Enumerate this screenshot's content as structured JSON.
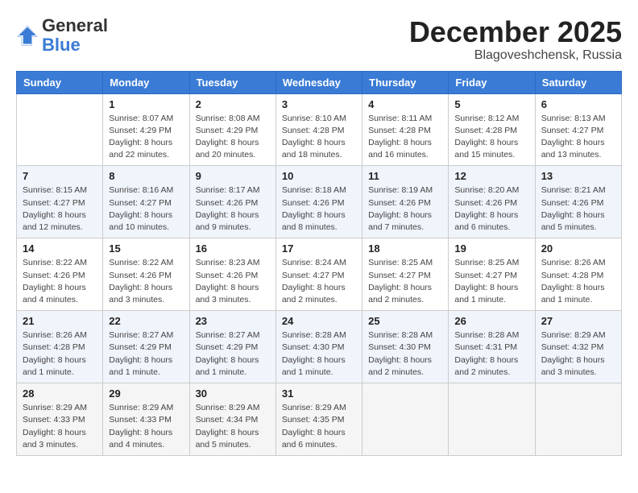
{
  "logo": {
    "general": "General",
    "blue": "Blue"
  },
  "title": {
    "month": "December 2025",
    "location": "Blagoveshchensk, Russia"
  },
  "weekdays": [
    "Sunday",
    "Monday",
    "Tuesday",
    "Wednesday",
    "Thursday",
    "Friday",
    "Saturday"
  ],
  "weeks": [
    [
      {
        "day": "",
        "info": ""
      },
      {
        "day": "1",
        "info": "Sunrise: 8:07 AM\nSunset: 4:29 PM\nDaylight: 8 hours\nand 22 minutes."
      },
      {
        "day": "2",
        "info": "Sunrise: 8:08 AM\nSunset: 4:29 PM\nDaylight: 8 hours\nand 20 minutes."
      },
      {
        "day": "3",
        "info": "Sunrise: 8:10 AM\nSunset: 4:28 PM\nDaylight: 8 hours\nand 18 minutes."
      },
      {
        "day": "4",
        "info": "Sunrise: 8:11 AM\nSunset: 4:28 PM\nDaylight: 8 hours\nand 16 minutes."
      },
      {
        "day": "5",
        "info": "Sunrise: 8:12 AM\nSunset: 4:28 PM\nDaylight: 8 hours\nand 15 minutes."
      },
      {
        "day": "6",
        "info": "Sunrise: 8:13 AM\nSunset: 4:27 PM\nDaylight: 8 hours\nand 13 minutes."
      }
    ],
    [
      {
        "day": "7",
        "info": "Sunrise: 8:15 AM\nSunset: 4:27 PM\nDaylight: 8 hours\nand 12 minutes."
      },
      {
        "day": "8",
        "info": "Sunrise: 8:16 AM\nSunset: 4:27 PM\nDaylight: 8 hours\nand 10 minutes."
      },
      {
        "day": "9",
        "info": "Sunrise: 8:17 AM\nSunset: 4:26 PM\nDaylight: 8 hours\nand 9 minutes."
      },
      {
        "day": "10",
        "info": "Sunrise: 8:18 AM\nSunset: 4:26 PM\nDaylight: 8 hours\nand 8 minutes."
      },
      {
        "day": "11",
        "info": "Sunrise: 8:19 AM\nSunset: 4:26 PM\nDaylight: 8 hours\nand 7 minutes."
      },
      {
        "day": "12",
        "info": "Sunrise: 8:20 AM\nSunset: 4:26 PM\nDaylight: 8 hours\nand 6 minutes."
      },
      {
        "day": "13",
        "info": "Sunrise: 8:21 AM\nSunset: 4:26 PM\nDaylight: 8 hours\nand 5 minutes."
      }
    ],
    [
      {
        "day": "14",
        "info": "Sunrise: 8:22 AM\nSunset: 4:26 PM\nDaylight: 8 hours\nand 4 minutes."
      },
      {
        "day": "15",
        "info": "Sunrise: 8:22 AM\nSunset: 4:26 PM\nDaylight: 8 hours\nand 3 minutes."
      },
      {
        "day": "16",
        "info": "Sunrise: 8:23 AM\nSunset: 4:26 PM\nDaylight: 8 hours\nand 3 minutes."
      },
      {
        "day": "17",
        "info": "Sunrise: 8:24 AM\nSunset: 4:27 PM\nDaylight: 8 hours\nand 2 minutes."
      },
      {
        "day": "18",
        "info": "Sunrise: 8:25 AM\nSunset: 4:27 PM\nDaylight: 8 hours\nand 2 minutes."
      },
      {
        "day": "19",
        "info": "Sunrise: 8:25 AM\nSunset: 4:27 PM\nDaylight: 8 hours\nand 1 minute."
      },
      {
        "day": "20",
        "info": "Sunrise: 8:26 AM\nSunset: 4:28 PM\nDaylight: 8 hours\nand 1 minute."
      }
    ],
    [
      {
        "day": "21",
        "info": "Sunrise: 8:26 AM\nSunset: 4:28 PM\nDaylight: 8 hours\nand 1 minute."
      },
      {
        "day": "22",
        "info": "Sunrise: 8:27 AM\nSunset: 4:29 PM\nDaylight: 8 hours\nand 1 minute."
      },
      {
        "day": "23",
        "info": "Sunrise: 8:27 AM\nSunset: 4:29 PM\nDaylight: 8 hours\nand 1 minute."
      },
      {
        "day": "24",
        "info": "Sunrise: 8:28 AM\nSunset: 4:30 PM\nDaylight: 8 hours\nand 1 minute."
      },
      {
        "day": "25",
        "info": "Sunrise: 8:28 AM\nSunset: 4:30 PM\nDaylight: 8 hours\nand 2 minutes."
      },
      {
        "day": "26",
        "info": "Sunrise: 8:28 AM\nSunset: 4:31 PM\nDaylight: 8 hours\nand 2 minutes."
      },
      {
        "day": "27",
        "info": "Sunrise: 8:29 AM\nSunset: 4:32 PM\nDaylight: 8 hours\nand 3 minutes."
      }
    ],
    [
      {
        "day": "28",
        "info": "Sunrise: 8:29 AM\nSunset: 4:33 PM\nDaylight: 8 hours\nand 3 minutes."
      },
      {
        "day": "29",
        "info": "Sunrise: 8:29 AM\nSunset: 4:33 PM\nDaylight: 8 hours\nand 4 minutes."
      },
      {
        "day": "30",
        "info": "Sunrise: 8:29 AM\nSunset: 4:34 PM\nDaylight: 8 hours\nand 5 minutes."
      },
      {
        "day": "31",
        "info": "Sunrise: 8:29 AM\nSunset: 4:35 PM\nDaylight: 8 hours\nand 6 minutes."
      },
      {
        "day": "",
        "info": ""
      },
      {
        "day": "",
        "info": ""
      },
      {
        "day": "",
        "info": ""
      }
    ]
  ]
}
